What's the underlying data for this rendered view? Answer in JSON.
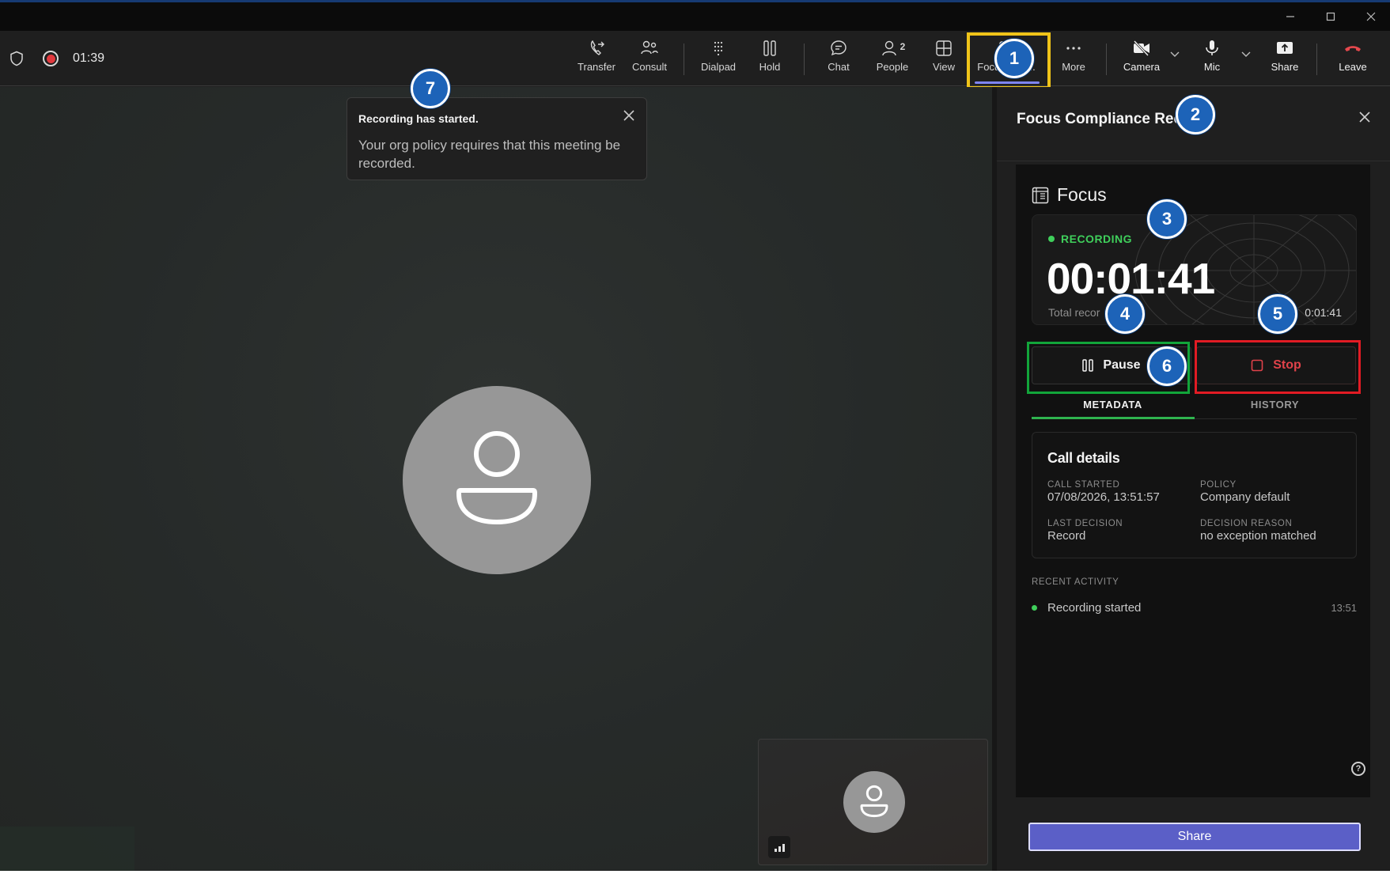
{
  "window": {
    "controls": [
      "minimize-icon",
      "maximize-icon",
      "close-icon"
    ]
  },
  "call": {
    "elapsed": "01:39"
  },
  "toolbar": {
    "transfer": "Transfer",
    "consult": "Consult",
    "dialpad": "Dialpad",
    "hold": "Hold",
    "chat": "Chat",
    "people": "People",
    "people_count": "2",
    "view": "View",
    "focus": "Focus",
    "focus_suffix": "p...",
    "more": "More",
    "camera": "Camera",
    "mic": "Mic",
    "share": "Share",
    "leave": "Leave"
  },
  "toast": {
    "title": "Recording has started.",
    "body": "Your org policy requires that this meeting be recorded."
  },
  "panel": {
    "title": "Focus Compliance Rec",
    "brand": "Focus",
    "status": "RECORDING",
    "timer": "00:01:41",
    "total_label": "Total recor",
    "total_suffix": "e",
    "length_label": "LE",
    "length_value": "0:01:41",
    "pause_label": "Pause",
    "stop_label": "Stop",
    "tabs": [
      "METADATA",
      "HISTORY"
    ],
    "details": {
      "title": "Call details",
      "call_started_label": "CALL STARTED",
      "call_started_value": "07/08/2026, 13:51:57",
      "policy_label": "POLICY",
      "policy_value": "Company default",
      "last_decision_label": "LAST DECISION",
      "last_decision_value": "Record",
      "decision_reason_label": "DECISION REASON",
      "decision_reason_value": "no exception matched"
    },
    "recent_label": "RECENT ACTIVITY",
    "recent_items": [
      {
        "text": "Recording started",
        "time": "13:51"
      }
    ],
    "share_label": "Share"
  },
  "annotations": [
    "1",
    "2",
    "3",
    "4",
    "5",
    "6",
    "7"
  ],
  "colors": {
    "accent": "#5b5fc7",
    "recording_green": "#3fcf5b",
    "stop_red": "#e0424a",
    "badge_blue": "#1d63b8"
  }
}
